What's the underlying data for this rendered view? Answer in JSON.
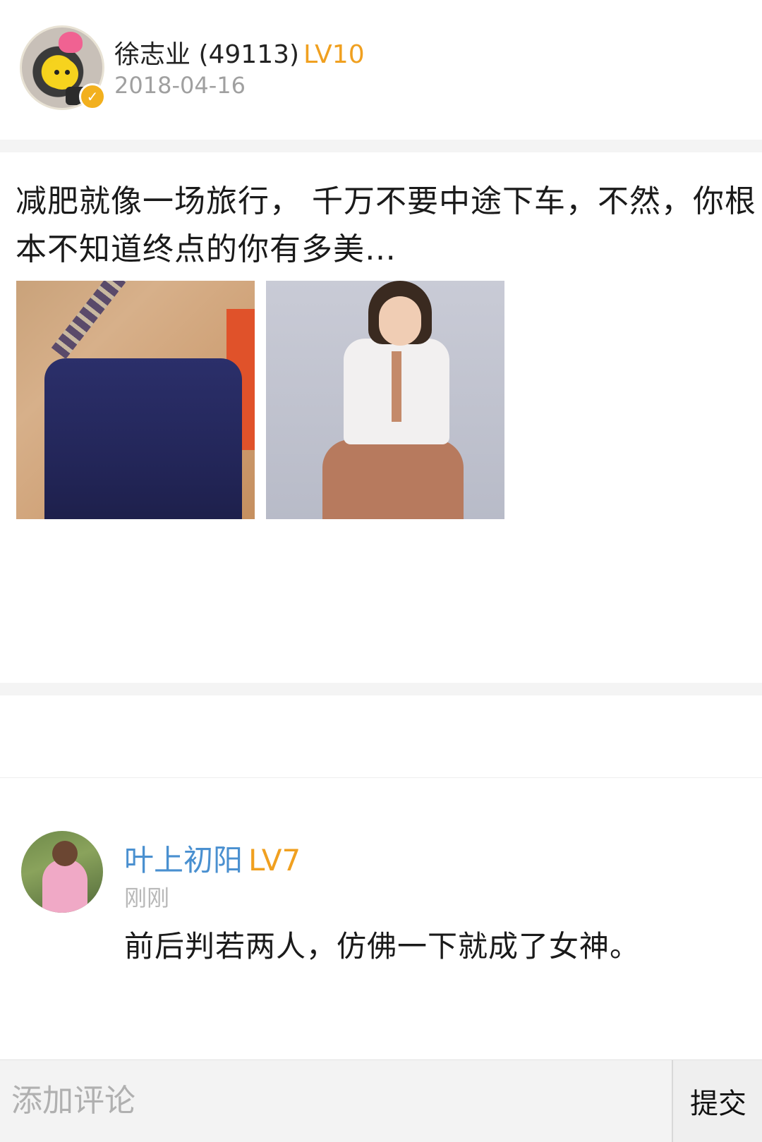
{
  "post": {
    "author_name": "徐志业 (49113)",
    "author_level": "LV10",
    "date": "2018-04-16",
    "text": "减肥就像一场旅行，  千万不要中途下车，不然，你根本不知道终点的你有多美…",
    "photos": [
      "photo-before",
      "photo-after"
    ]
  },
  "comment": {
    "user": "叶上初阳",
    "level": "LV7",
    "time": "刚刚",
    "text": "前后判若两人，仿佛一下就成了女神。"
  },
  "input_bar": {
    "placeholder": "添加评论",
    "submit_label": "提交"
  },
  "colors": {
    "level": "#f0a020",
    "comment_user": "#4a90d0",
    "muted": "#a0a0a0",
    "verified_badge": "#f2b01e"
  }
}
